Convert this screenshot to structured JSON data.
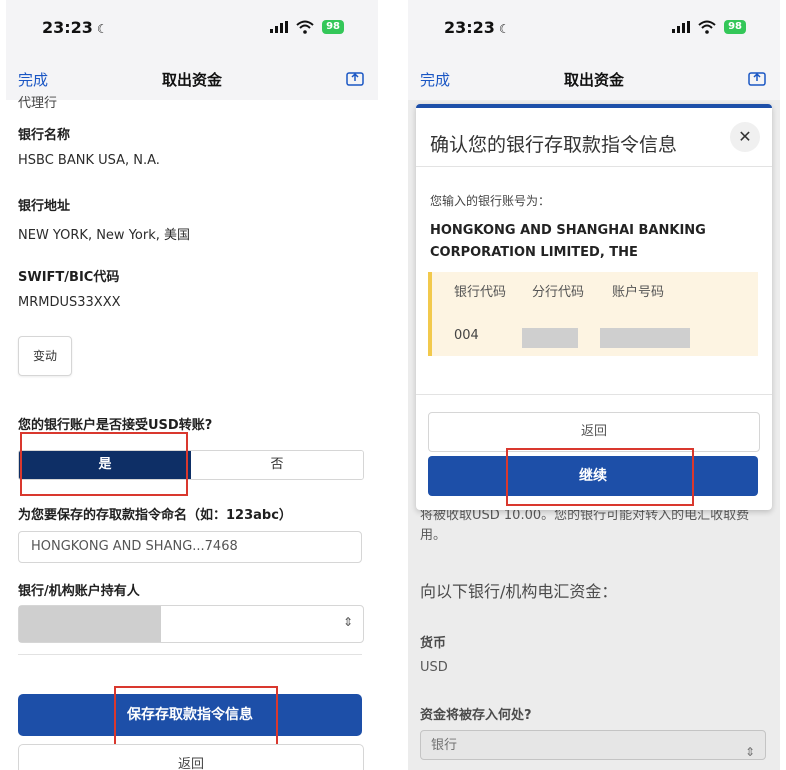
{
  "status": {
    "time": "23:23",
    "battery": "98"
  },
  "left": {
    "nav": {
      "done": "完成",
      "title": "取出资金"
    },
    "cut_text": "代理行",
    "bank_name_label": "银行名称",
    "bank_name_value": "HSBC BANK USA, N.A.",
    "bank_address_label": "银行地址",
    "bank_address_value": "NEW YORK, New York, 美国",
    "swift_label": "SWIFT/BIC代码",
    "swift_value": "MRMDUS33XXX",
    "change_button": "变动",
    "usd_question": "您的银行账户是否接受USD转账?",
    "yes": "是",
    "no": "否",
    "name_instruction_label": "为您要保存的存取款指令命名（如：123abc）",
    "name_instruction_value": "HONGKONG AND SHANG...7468",
    "holder_label": "银行/机构账户持有人",
    "save_button": "保存存取款指令信息",
    "back_button": "返回"
  },
  "right": {
    "nav": {
      "done": "完成",
      "title": "取出资金"
    },
    "modal": {
      "title": "确认您的银行存取款指令信息",
      "close": "✕",
      "prompt": "您输入的银行账号为：",
      "bank_name": "HONGKONG AND SHANGHAI BANKING CORPORATION LIMITED, THE",
      "col_bank_code": "银行代码",
      "col_branch_code": "分行代码",
      "col_account": "账户号码",
      "bank_code_value": "004",
      "back_button": "返回",
      "continue_button": "继续"
    },
    "under": {
      "fee_text": "将被收取USD 10.00。您的银行可能对转入的电汇收取费用。",
      "wire_heading": "向以下银行/机构电汇资金：",
      "currency_label": "货币",
      "currency_value": "USD",
      "deposit_label": "资金将被存入何处?",
      "deposit_value": "银行"
    }
  },
  "colors": {
    "accent": "#1d4fa8",
    "highlight": "#d9382e",
    "segment_selected": "#0e2f66"
  },
  "icons": [
    "moon-icon",
    "signal-icon",
    "wifi-icon",
    "battery-icon",
    "share-icon",
    "chevron-updown-icon",
    "close-icon"
  ]
}
